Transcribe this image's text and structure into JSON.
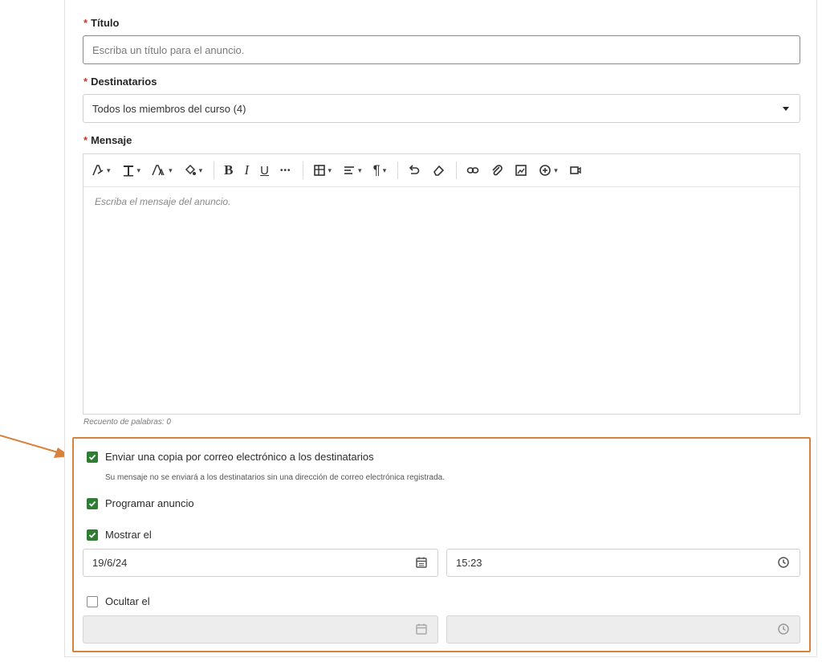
{
  "title": {
    "label": "Título",
    "placeholder": "Escriba un título para el anuncio."
  },
  "recipients": {
    "label": "Destinatarios",
    "selected": "Todos los miembros del curso (4)"
  },
  "message": {
    "label": "Mensaje",
    "placeholder": "Escriba el mensaje del anuncio.",
    "word_count": "Recuento de palabras: 0"
  },
  "toolbar": {
    "icons": [
      "paragraph-style-icon",
      "text-format-icon",
      "font-size-icon",
      "text-color-icon",
      "bold-icon",
      "italic-icon",
      "underline-icon",
      "more-icon",
      "table-icon",
      "align-icon",
      "paragraph-icon",
      "undo-icon",
      "eraser-icon",
      "link-icon",
      "attach-icon",
      "image-icon",
      "insert-icon",
      "media-icon"
    ],
    "bold": "B",
    "italic": "I",
    "underline": "U",
    "more": "•••",
    "paragraph": "¶"
  },
  "required_mark": "*",
  "options": {
    "email_copy": {
      "label": "Enviar una copia por correo electrónico a los destinatarios",
      "checked": true
    },
    "email_help": "Su mensaje no se enviará a los destinatarios sin una dirección de correo electrónica registrada.",
    "schedule": {
      "label": "Programar anuncio",
      "checked": true
    },
    "show_on": {
      "label": "Mostrar el",
      "checked": true,
      "date": "19/6/24",
      "time": "15:23"
    },
    "hide_on": {
      "label": "Ocultar el",
      "checked": false,
      "date": "",
      "time": ""
    }
  },
  "colors": {
    "accent_check": "#2e7d32",
    "highlight_box": "#d9823b",
    "required": "#c0392b"
  }
}
